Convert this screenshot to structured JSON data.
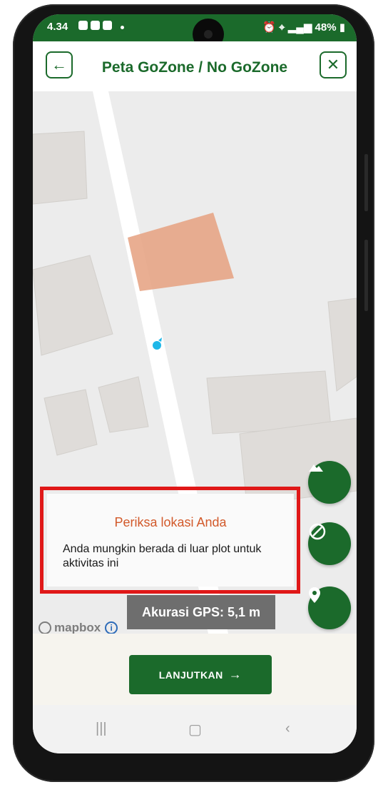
{
  "status_bar": {
    "time": "4.34",
    "battery": "48%"
  },
  "header": {
    "title": "Peta GoZone / No GoZone"
  },
  "map": {
    "attribution": "mapbox",
    "gps_accuracy": "Akurasi GPS: 5,1 m"
  },
  "message": {
    "title": "Periksa lokasi Anda",
    "body": "Anda mungkin berada di luar plot untuk aktivitas ini"
  },
  "actions": {
    "continue_label": "LANJUTKAN"
  },
  "icons": {
    "back": "arrow-left-icon",
    "close": "close-icon",
    "terrain": "mountain-icon",
    "no_gozone": "block-icon",
    "location": "location-pin-icon"
  },
  "colors": {
    "primary": "#1b6a2b",
    "plot": "#e7a586",
    "warning_title": "#d2592a",
    "highlight_border": "#e01818"
  }
}
